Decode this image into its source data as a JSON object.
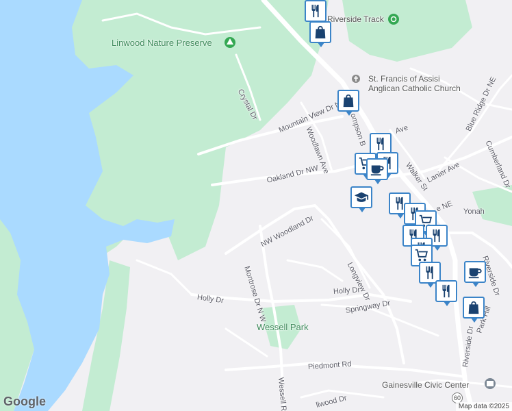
{
  "map": {
    "parks": {
      "linwood": "Linwood Nature Preserve",
      "wessell": "Wessell Park"
    },
    "pois": {
      "riverside_track": "Riverside Track",
      "church_line1": "St. Francis of Assisi",
      "church_line2": "Anglican Catholic Church",
      "civic_center": "Gainesville Civic Center"
    },
    "roads": {
      "crystal": "Crystal Dr",
      "mountain_view": "Mountain View Dr N",
      "woodlawn": "Woodlawn Ave",
      "thompson": "ompson B",
      "oakland": "Oakland Dr NW",
      "ave": "Ave",
      "walker": "Walker St",
      "lanier": "Lanier Ave",
      "blue_ridge": "Blue Ridge Dr NE",
      "cumberland": "Cumberland Dr",
      "yonah": "Yonah",
      "ne": "e NE",
      "nw_woodland": "NW Woodland Dr",
      "montrose": "Montrose Dr N W",
      "longview": "Longview Dr",
      "holly_w": "Holly Dr",
      "holly_e": "Holly Dr",
      "springway": "Springway Dr",
      "riverside_dr_n": "Riverside Dr",
      "riverside_dr_s": "Riverside Dr",
      "park_hill": "Park Hill",
      "piedmont": "Piedmont Rd",
      "wessell_rd": "Wessell Rd",
      "lwood": "llwood Dr"
    },
    "route_shield": "60",
    "colors": {
      "water": "#aadaff",
      "park": "#c3ecd2",
      "land": "#f1f0f3",
      "road": "#ffffff",
      "marker_border": "#3b84c8",
      "marker_icon": "#1a4270"
    }
  },
  "markers": [
    {
      "icon": "restaurant-icon"
    },
    {
      "icon": "shopping-bag-icon"
    },
    {
      "icon": "shopping-bag-icon"
    },
    {
      "icon": "restaurant-icon"
    },
    {
      "icon": "shopping-cart-icon"
    },
    {
      "icon": "restaurant-icon"
    },
    {
      "icon": "coffee-cup-icon"
    },
    {
      "icon": "school-icon"
    },
    {
      "icon": "restaurant-icon"
    },
    {
      "icon": "restaurant-icon"
    },
    {
      "icon": "shopping-cart-icon"
    },
    {
      "icon": "restaurant-icon"
    },
    {
      "icon": "restaurant-icon"
    },
    {
      "icon": "restaurant-icon"
    },
    {
      "icon": "shopping-cart-icon"
    },
    {
      "icon": "restaurant-icon"
    },
    {
      "icon": "coffee-cup-icon"
    },
    {
      "icon": "restaurant-icon"
    },
    {
      "icon": "shopping-bag-icon"
    }
  ],
  "branding": {
    "logo": "Google",
    "attribution": "Map data ©2025"
  }
}
